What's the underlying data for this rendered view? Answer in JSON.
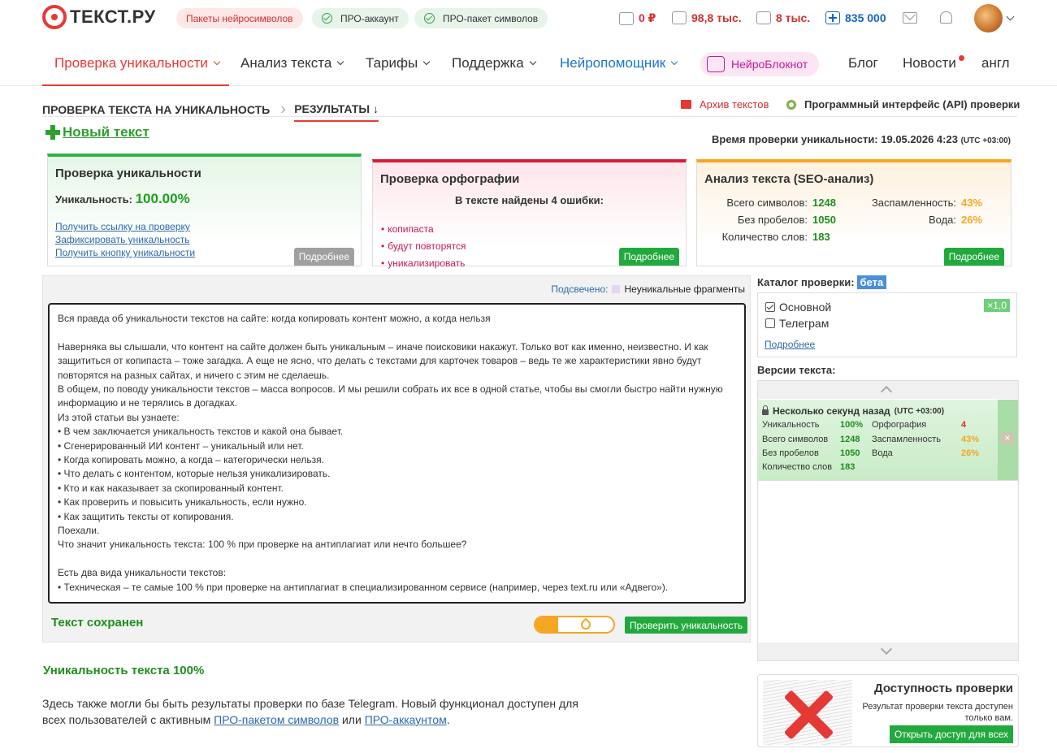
{
  "header": {
    "logo_text": "ТЕКСТ.РУ",
    "pill_neuro_packages": "Пакеты нейросимволов",
    "pill_pro_account": "ПРО-аккаунт",
    "pill_pro_package": "ПРО-пакет символов",
    "balance": "0 ₽",
    "symbols": "98,8 тыс.",
    "calendar": "8 тыс.",
    "points": "835 000"
  },
  "nav": {
    "items": [
      {
        "label": "Проверка уникальности"
      },
      {
        "label": "Анализ текста"
      },
      {
        "label": "Тарифы"
      },
      {
        "label": "Поддержка"
      },
      {
        "label": "Нейропомощник"
      },
      {
        "label": "НейроБлокнот"
      },
      {
        "label": "Блог"
      },
      {
        "label": "Новости"
      },
      {
        "label": "англ"
      }
    ]
  },
  "breadcrumb": {
    "root": "ПРОВЕРКА ТЕКСТА НА УНИКАЛЬНОСТЬ",
    "current": "РЕЗУЛЬТАТЫ ↓",
    "archive": "Архив текстов",
    "api": "Программный интерфейс (API) проверки"
  },
  "new_text": "Новый текст",
  "check_time": {
    "label": "Время проверки уникальности: 19.05.2026 4:23",
    "tz": "(UTC +03:00)"
  },
  "uniqueness_panel": {
    "title": "Проверка уникальности",
    "label": "Уникальность:",
    "value": "100.00%",
    "links": [
      "Получить ссылку на проверку",
      "Зафиксировать уникальность",
      "Получить кнопку уникальности"
    ],
    "more": "Подробнее"
  },
  "spelling_panel": {
    "title": "Проверка орфографии",
    "summary": "В тексте найдены 4 ошибки:",
    "errors": [
      "копипаста",
      "будут повторятся",
      "уникализировать"
    ],
    "more": "Подробнее"
  },
  "seo_panel": {
    "title": "Анализ текста (SEO-анализ)",
    "total_chars_label": "Всего символов:",
    "total_chars": "1248",
    "no_spaces_label": "Без пробелов:",
    "no_spaces": "1050",
    "words_label": "Количество слов:",
    "words": "183",
    "spam_label": "Заспамленность:",
    "spam": "43%",
    "water_label": "Вода:",
    "water": "26%",
    "more": "Подробнее"
  },
  "editor": {
    "highlight_label": "Подсвечено:",
    "highlight_legend": "Неуникальные фрагменты",
    "lines": [
      "Вся правда об уникальности текстов на сайте: когда копировать контент можно, а когда нельзя",
      "",
      "Наверняка вы слышали, что контент на сайте должен быть уникальным – иначе поисковики накажут. Только вот как именно, неизвестно. И как защититься от копипаста – тоже загадка. А еще не ясно, что делать с текстами для карточек товаров – ведь те же характеристики явно будут повторятся на разных сайтах, и ничего с этим не сделаешь.",
      "В общем, по поводу уникальности текстов – масса вопросов. И мы решили собрать их все в одной статье, чтобы вы смогли быстро найти нужную информацию и не терялись в догадках.",
      "Из этой статьи вы узнаете:",
      "• В чем заключается уникальность текстов и какой она бывает.",
      "• Сгенерированный ИИ контент – уникальный или нет.",
      "• Когда копировать можно, а когда – категорически нельзя.",
      "• Что делать с контентом, которые нельзя уникализировать.",
      "• Кто и как наказывает за скопированный контент.",
      "• Как проверить и повысить уникальность, если нужно.",
      "• Как защитить тексты от копирования.",
      "Поехали.",
      "Что значит уникальность текста: 100 % при проверке на антиплагиат или нечто большее?",
      "",
      "Есть два вида уникальности текстов:",
      "• Техническая – те самые 100 % при проверке на антиплагиат в специализированном сервисе (например, через text.ru или «Адвего»)."
    ],
    "saved": "Текст сохранен",
    "check_button": "Проверить уникальность"
  },
  "catalog": {
    "title": "Каталог проверки:",
    "badge": "бета",
    "options": [
      {
        "label": "Основной",
        "checked": true
      },
      {
        "label": "Телеграм",
        "checked": false
      }
    ],
    "ratio": "×1,0",
    "more": "Подробнее"
  },
  "versions": {
    "title": "Версии текста:",
    "item": {
      "time": "Несколько секунд назад",
      "tz": "(UTC +03:00)",
      "uniq_label": "Уникальность",
      "uniq": "100%",
      "spell_label": "Орфография",
      "spell": "4",
      "total_label": "Всего символов",
      "total": "1248",
      "spam_label": "Заспамленность",
      "spam": "43%",
      "nospace_label": "Без пробелов",
      "nospace": "1050",
      "water_label": "Вода",
      "water": "26%",
      "words_label": "Количество слов",
      "words": "183"
    }
  },
  "availability": {
    "title": "Доступность проверки",
    "text": "Результат проверки текста доступен только вам.",
    "button": "Открыть доступ для всех"
  },
  "result": {
    "title": "Уникальность текста 100%",
    "text_before": "Здесь также могли бы быть результаты проверки по базе Telegram. Новый функционал доступен для всех пользователей с активным ",
    "link1": "ПРО-пакетом символов",
    "text_mid": " или ",
    "link2": "ПРО-аккаунтом",
    "text_after": "."
  },
  "colors": {
    "accent_red": "#e53935",
    "accent_green": "#22a93e",
    "accent_orange": "#f5a623",
    "link_blue": "#2c6aa8"
  }
}
